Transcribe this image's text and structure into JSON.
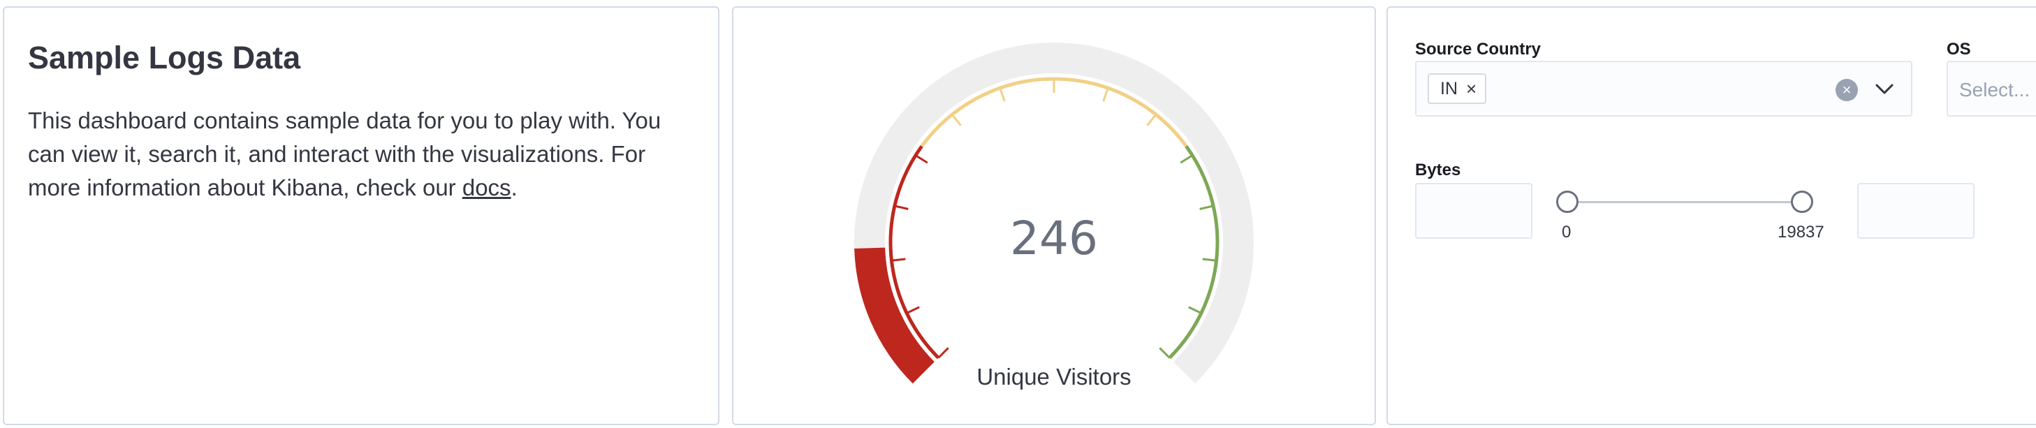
{
  "markdown": {
    "title": "Sample Logs Data",
    "text_before_link": "This dashboard contains sample data for you to play with. You can view it, search it, and interact with the visualizations. For more information about Kibana, check our ",
    "link_text": "docs",
    "text_after_link": "."
  },
  "gauge": {
    "value": "246",
    "label": "Unique Visitors",
    "colors": {
      "background": "#eeeeee",
      "low": "#bd271e",
      "mid": "#f1d086",
      "high": "#7da856",
      "value_fill": "#bd271e"
    }
  },
  "controls": {
    "source_country": {
      "label": "Source Country",
      "selected": [
        "IN"
      ],
      "icons": [
        "cross-icon",
        "clear-icon",
        "chevron-down-icon"
      ]
    },
    "os": {
      "label": "OS",
      "placeholder": "Select..."
    },
    "bytes": {
      "label": "Bytes",
      "min_label": "0",
      "max_label": "19837",
      "min_value": "",
      "max_value": ""
    }
  }
}
